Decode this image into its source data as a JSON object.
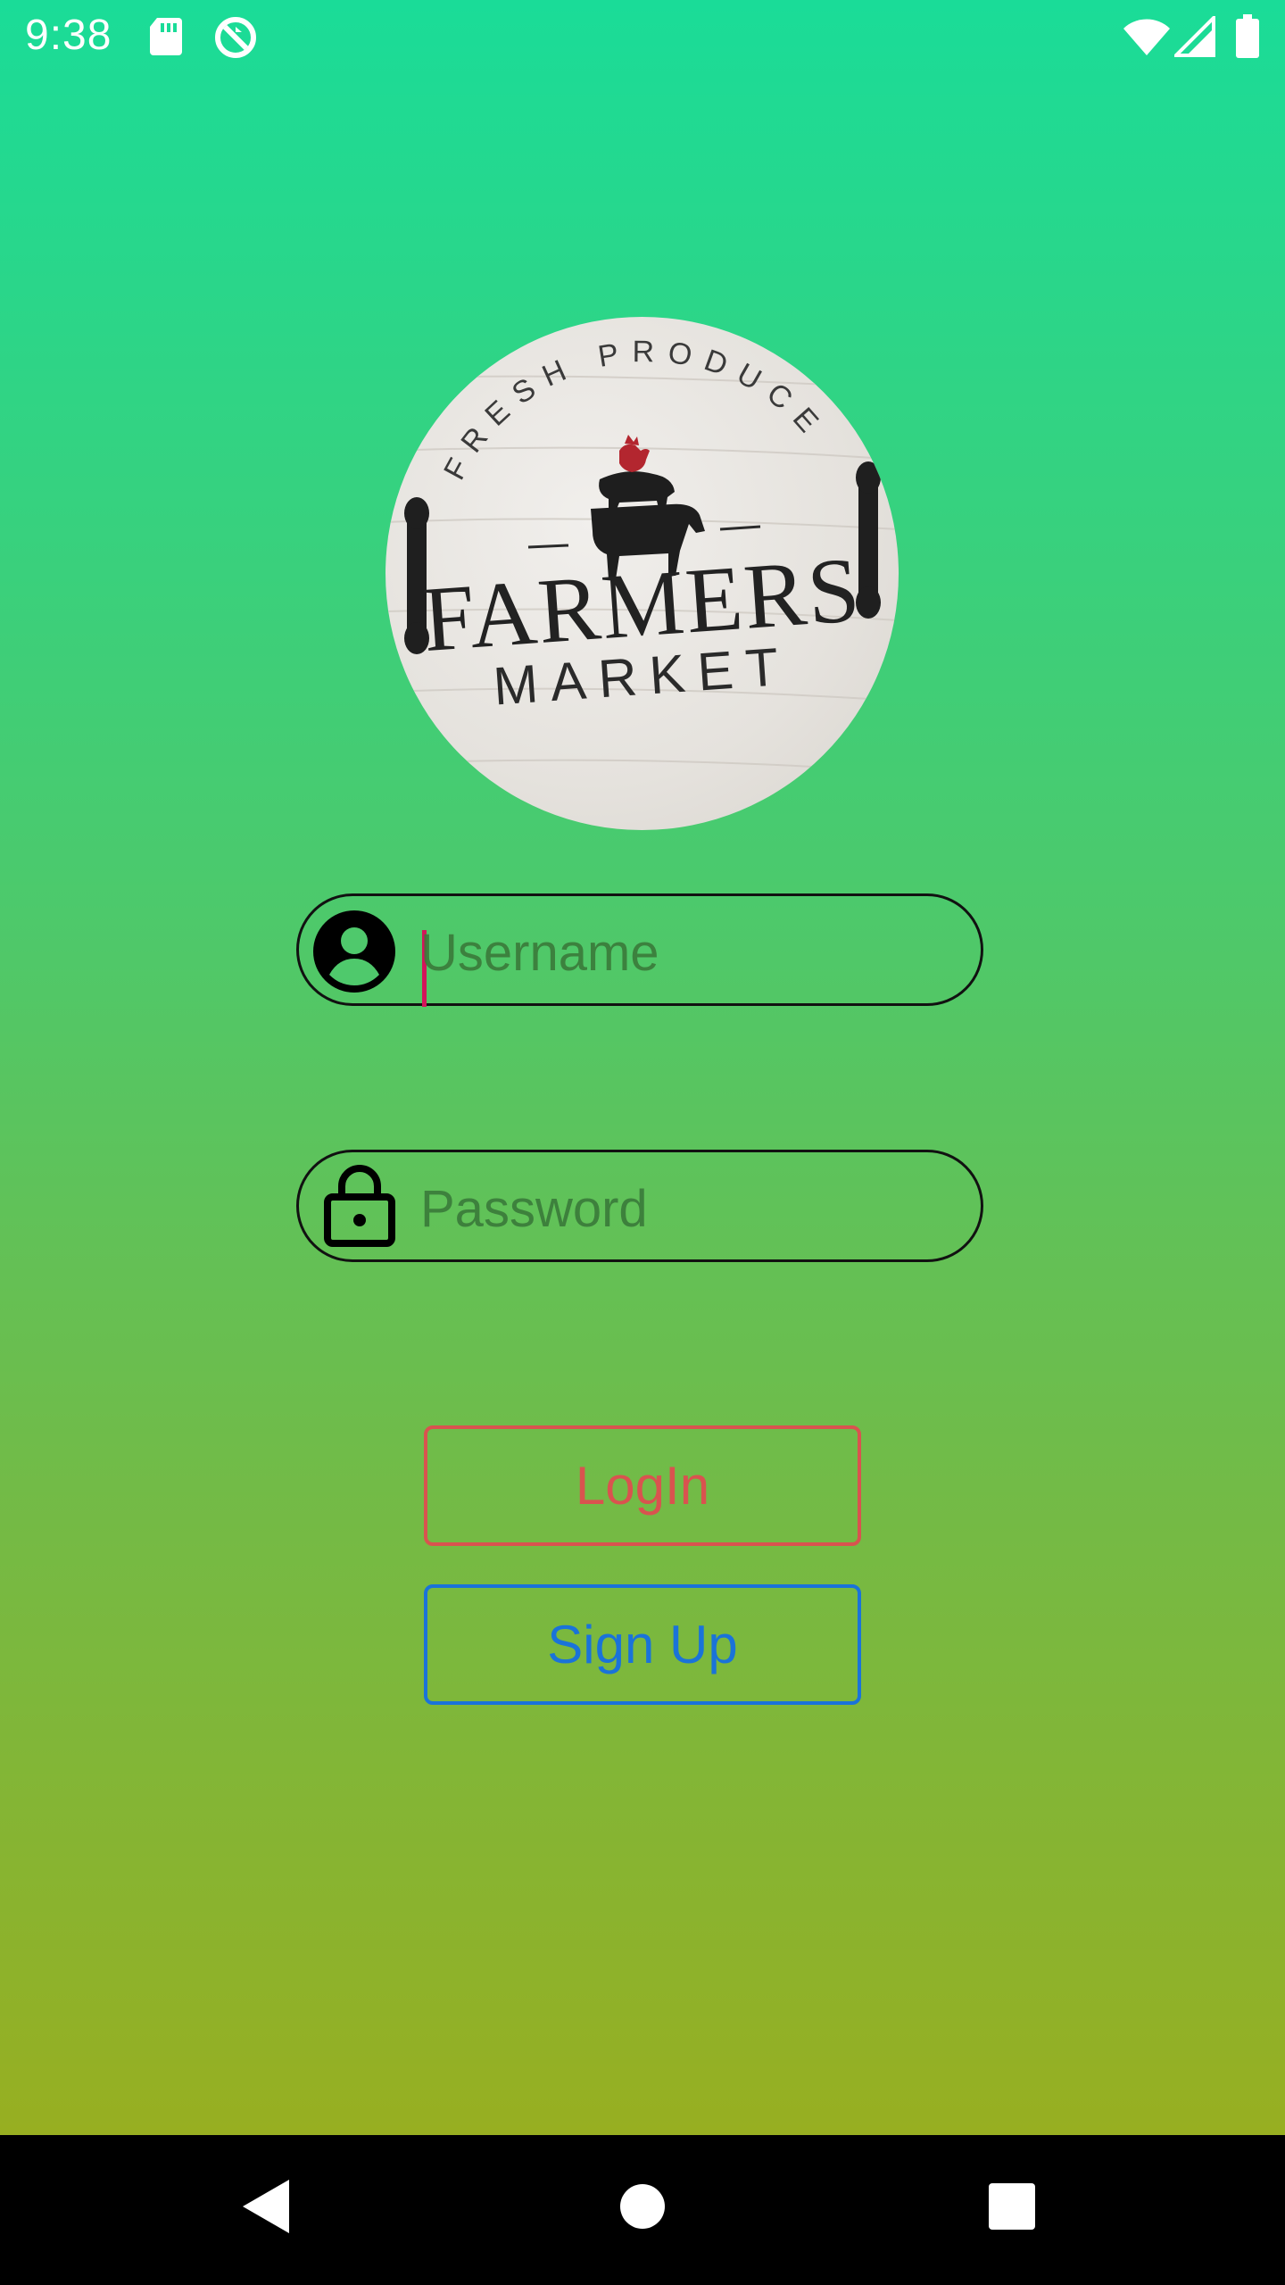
{
  "status_bar": {
    "time": "9:38",
    "left_icons": [
      "sd-card-icon",
      "sync-disabled-icon"
    ],
    "right_icons": [
      "wifi-icon",
      "cell-signal-icon",
      "battery-icon"
    ]
  },
  "logo": {
    "arc_text": "FRESH PRODUCE",
    "main_text": "FARMERS",
    "sub_text": "MARKET",
    "icon": "farm-animals-logo"
  },
  "form": {
    "username": {
      "placeholder": "Username",
      "value": "",
      "icon": "account-circle-icon"
    },
    "password": {
      "placeholder": "Password",
      "value": "",
      "icon": "lock-icon"
    }
  },
  "buttons": {
    "login_label": "LogIn",
    "signup_label": "Sign Up"
  },
  "colors": {
    "gradient_top": "#1adc98",
    "gradient_bottom": "#a0ac18",
    "login": "#d9534f",
    "signup": "#1a73d9",
    "cursor": "#d4145a"
  },
  "nav_bar": {
    "icons": [
      "back-icon",
      "home-icon",
      "recents-icon"
    ]
  }
}
